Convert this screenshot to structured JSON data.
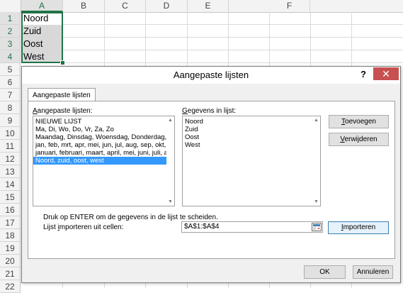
{
  "sheet": {
    "columns": [
      "A",
      "B",
      "C",
      "D",
      "E",
      "F"
    ],
    "rows": [
      "1",
      "2",
      "3",
      "4",
      "5",
      "6",
      "7",
      "8",
      "9",
      "10",
      "11",
      "12",
      "13",
      "14",
      "15",
      "16",
      "17",
      "18",
      "19",
      "20",
      "21",
      "22"
    ],
    "cells": [
      "Noord",
      "Zuid",
      "Oost",
      "West"
    ]
  },
  "dialog": {
    "title": "Aangepaste lijsten",
    "help": "?",
    "close": "✕",
    "tab": "Aangepaste lijsten",
    "lists_label_key": "A",
    "lists_label_rest": "angepaste lijsten:",
    "lists": [
      "NIEUWE LIJST",
      "Ma, Di, Wo, Do, Vr, Za, Zo",
      "Maandag, Dinsdag, Woensdag, Donderdag, Vrijdag, Zaterdag, Zondag",
      "jan, feb, mrt, apr, mei, jun, jul, aug, sep, okt, nov, dec",
      "januari, februari, maart, april, mei, juni, juli, augustus, september, oktober, november, december",
      "Noord, zuid, oost, west"
    ],
    "entries_label_key": "G",
    "entries_label_rest": "egevens in lijst:",
    "entries": [
      "Noord",
      "Zuid",
      "Oost",
      "West"
    ],
    "add_key": "T",
    "add_rest": "oevoegen",
    "delete_key": "V",
    "delete_rest": "erwijderen",
    "hint": "Druk op ENTER om de gegevens in de lijst te scheiden.",
    "import_label_pre": "Lijst ",
    "import_label_key": "i",
    "import_label_rest": "mporteren uit cellen:",
    "import_range": "$A$1:$A$4",
    "import_key": "I",
    "import_rest": "mporteren",
    "ok": "OK",
    "cancel": "Annuleren"
  },
  "colors": {
    "accent": "#217346",
    "selection": "#3399ff",
    "close": "#c75050"
  }
}
